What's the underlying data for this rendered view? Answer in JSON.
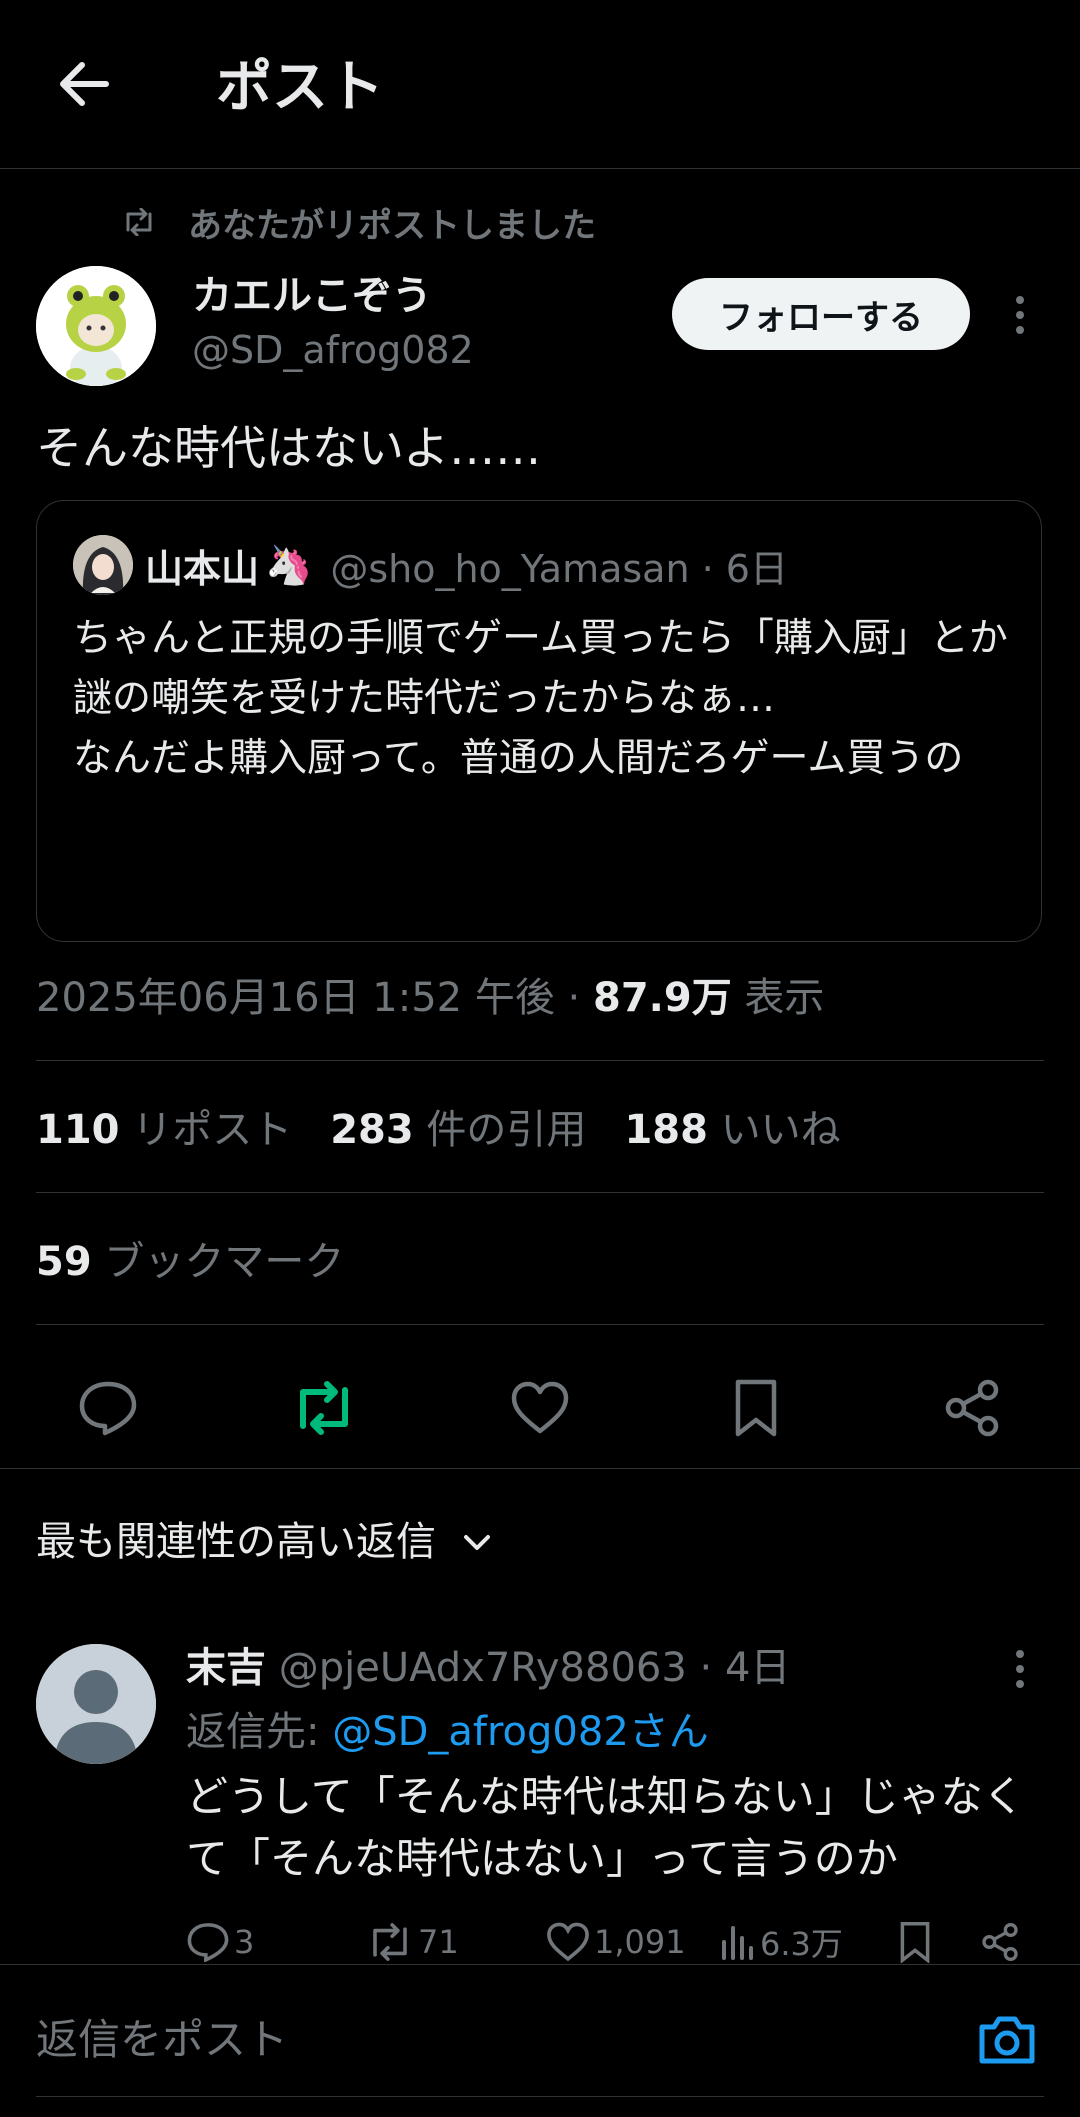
{
  "header": {
    "title": "ポスト",
    "back_icon": "arrow-left-icon"
  },
  "repost_notice": "あなたがリポストしました",
  "post": {
    "author_name": "カエルこぞう",
    "author_handle": "@SD_afrog082",
    "follow_label": "フォローする",
    "text": "そんな時代はないよ……",
    "timestamp": "2025年06月16日 1:52 午後 · ",
    "views_value": "87.9万",
    "views_label": " 表示"
  },
  "quote": {
    "name": "山本山",
    "emoji": "🦄",
    "handle_time": "@sho_ho_Yamasan · 6日",
    "text": "ちゃんと正規の手順でゲーム買ったら「購入厨」とか謎の嘲笑を受けた時代だったからなぁ…\nなんだよ購入厨って。普通の人間だろゲーム買うの"
  },
  "stats": {
    "reposts_value": "110",
    "reposts_label": " リポスト",
    "quotes_value": "283",
    "quotes_label": " 件の引用",
    "likes_value": "188",
    "likes_label": " いいね",
    "bookmarks_value": "59",
    "bookmarks_label": " ブックマーク"
  },
  "colors": {
    "accent": "#1d9bf0",
    "repost_active": "#00ba7c",
    "muted": "#71767b",
    "divider": "#2f3336"
  },
  "replies_section": {
    "sort_label": "最も関連性の高い返信"
  },
  "reply": {
    "name": "末吉",
    "handle_time": " @pjeUAdx7Ry88063 · 4日",
    "reply_to_prefix": "返信先: ",
    "reply_to_user": "@SD_afrog082さん",
    "text": "どうして「そんな時代は知らない」じゃなくて「そんな時代はない」って言うのか",
    "reply_count": "3",
    "repost_count": "71",
    "like_count": "1,091",
    "view_count": "6.3万"
  },
  "compose": {
    "placeholder": "返信をポスト"
  }
}
